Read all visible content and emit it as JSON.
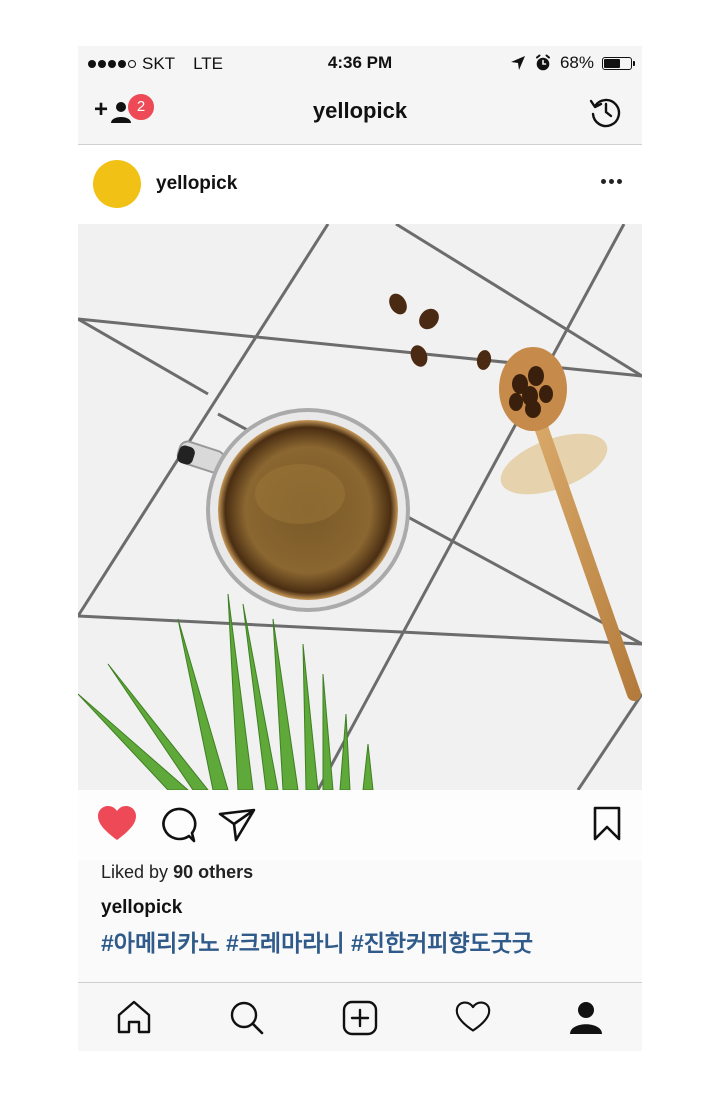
{
  "status_bar": {
    "carrier": "SKT",
    "network": "LTE",
    "time": "4:36 PM",
    "battery_percent": "68%",
    "battery_level": 0.68,
    "signal_filled": 4,
    "signal_total": 5
  },
  "header": {
    "title": "yellopick",
    "notification_count": "2",
    "add_user_icon": "add-user-icon",
    "history_icon": "history-icon"
  },
  "post": {
    "username": "yellopick",
    "avatar_color": "#f2c115",
    "likes_prefix": "Liked by",
    "likes_count": "90 others",
    "caption_user": "yellopick",
    "hashtags": "#아메리카노 #크레마라니 #진한커피향도굿굿",
    "liked": true,
    "like_color": "#ed4956",
    "hashtag_color": "#2f5a8a"
  },
  "tab_bar": {
    "items": [
      "home-icon",
      "search-icon",
      "new-post-icon",
      "activity-icon",
      "profile-icon"
    ],
    "active": "profile-icon"
  }
}
